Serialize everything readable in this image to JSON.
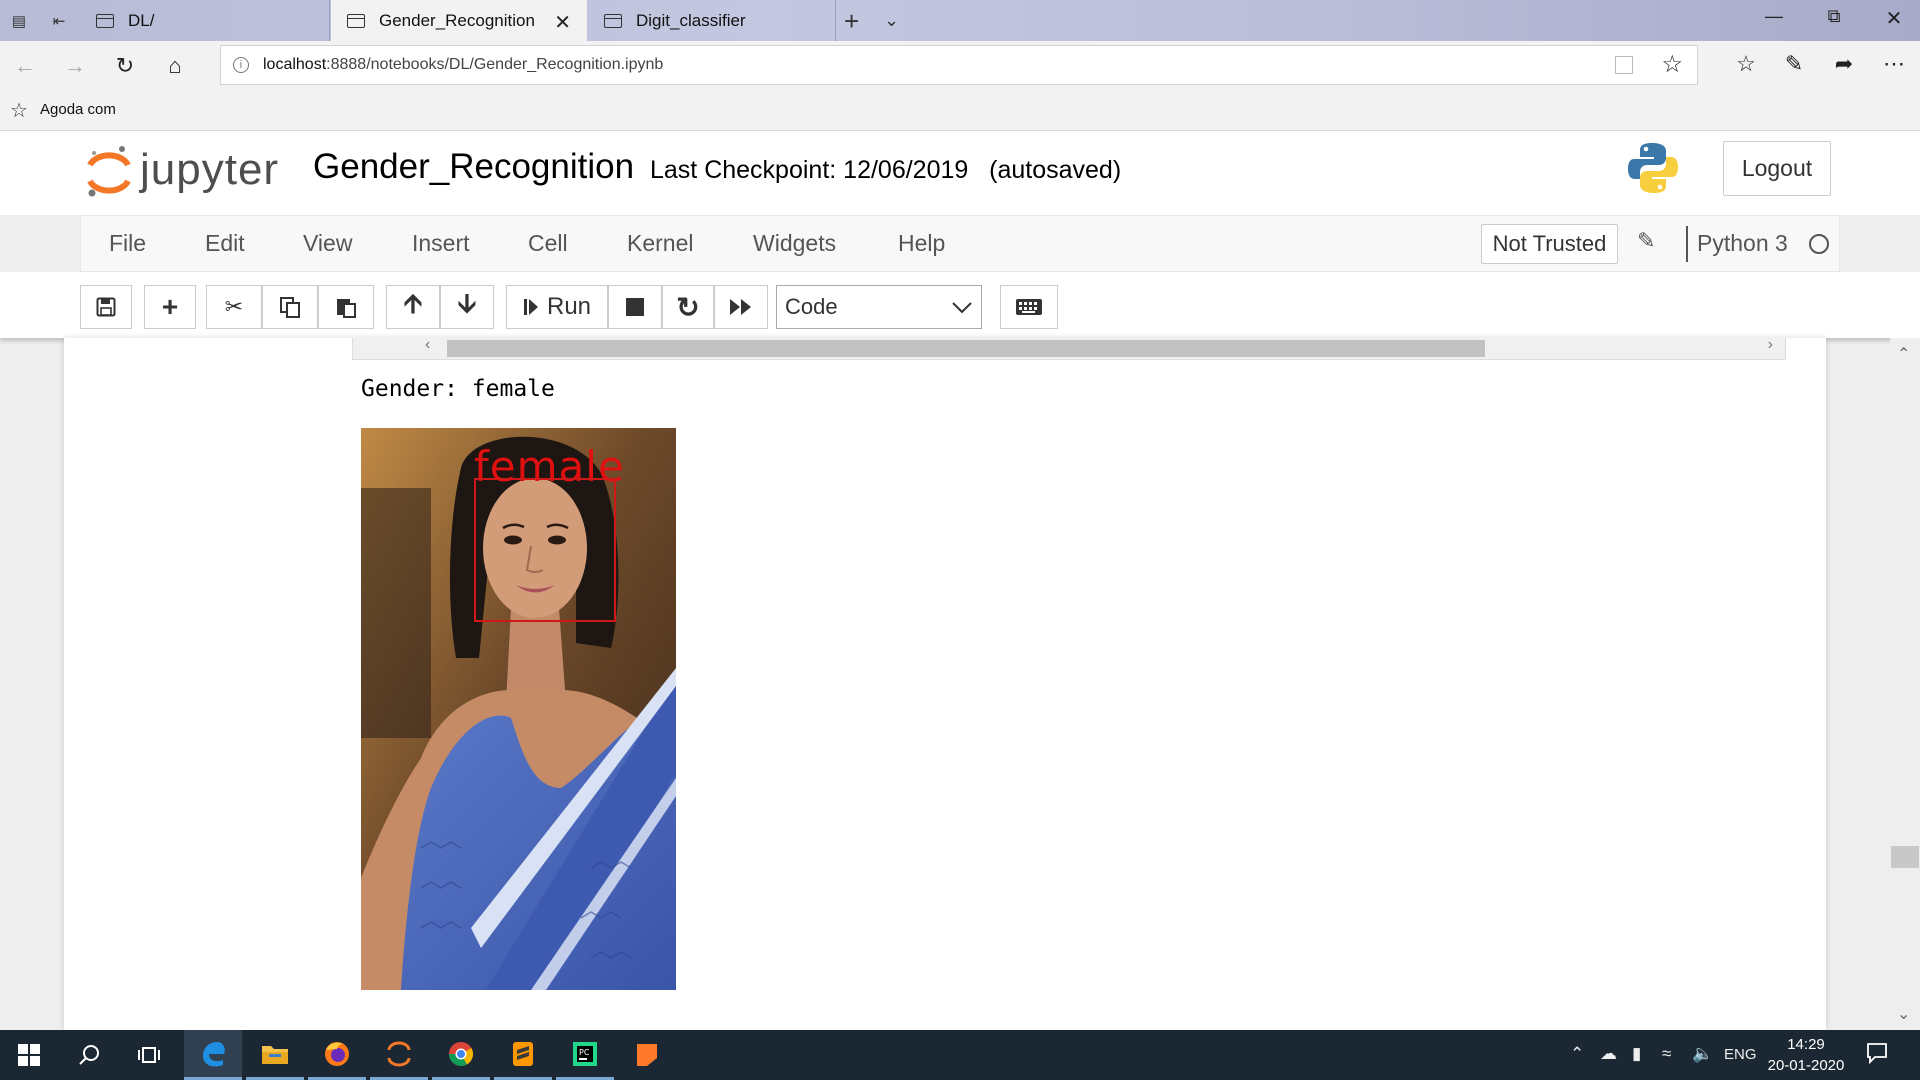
{
  "browser": {
    "tabs": [
      {
        "label": "DL/",
        "active": false
      },
      {
        "label": "Gender_Recognition",
        "active": true
      },
      {
        "label": "Digit_classifier",
        "active": false
      }
    ],
    "url_host": "localhost",
    "url_rest": ":8888/notebooks/DL/Gender_Recognition.ipynb",
    "favorites": [
      {
        "label": "Agoda com"
      }
    ]
  },
  "jupyter": {
    "logo_text": "jupyter",
    "notebook_title": "Gender_Recognition",
    "checkpoint": "Last Checkpoint: 12/06/2019   (autosaved)",
    "logout_label": "Logout",
    "menu": [
      "File",
      "Edit",
      "View",
      "Insert",
      "Cell",
      "Kernel",
      "Widgets",
      "Help"
    ],
    "trust_label": "Not Trusted",
    "kernel_name": "Python 3",
    "run_label": "Run",
    "cell_type": "Code"
  },
  "output": {
    "text": "Gender: female",
    "detection_label": "female"
  },
  "taskbar": {
    "language": "ENG",
    "time": "14:29",
    "date": "20-01-2020"
  },
  "colors": {
    "tabbar": "#b7bbd6",
    "detection_box": "#d01818",
    "taskbar": "#1b2833",
    "jupyter_orange": "#f37726"
  }
}
